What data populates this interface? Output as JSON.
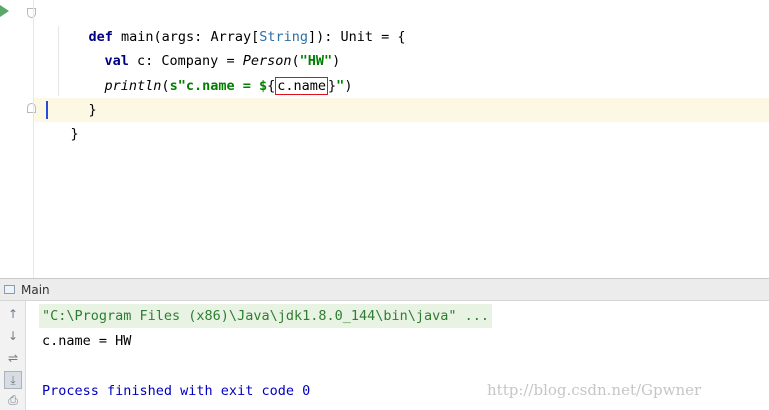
{
  "editor": {
    "lines": [
      {
        "kw": "def",
        "name": " main(args: Array[",
        "type": "String",
        "rest": "]): Unit = {"
      },
      {
        "kw": "val",
        "rest": " c: Company = ",
        "italic": "Person",
        "open": "(",
        "str": "\"HW\"",
        "close": ")"
      },
      {
        "italic": "println",
        "open": "(",
        "str1": "s\"c.name = ",
        "str2": "$",
        "brace_open": "{",
        "boxed": "c.name",
        "brace_close": "}",
        "str3": "\"",
        "close": ")"
      },
      {
        "text": "}"
      },
      {
        "text": "}"
      }
    ]
  },
  "tool_window": {
    "title": "Main",
    "console": {
      "command": "\"C:\\Program Files (x86)\\Java\\jdk1.8.0_144\\bin\\java\" ...",
      "output": "c.name = HW",
      "exit": "Process finished with exit code 0"
    },
    "side_buttons": [
      {
        "icon": "up-arrow-icon",
        "glyph": "↑"
      },
      {
        "icon": "down-arrow-icon",
        "glyph": "↓"
      },
      {
        "icon": "soft-wrap-icon",
        "glyph": "⇌"
      },
      {
        "icon": "scroll-to-end-icon",
        "glyph": "⤓"
      },
      {
        "icon": "print-icon",
        "glyph": "⎙"
      }
    ]
  },
  "watermark": "http://blog.csdn.net/Gpwner",
  "colors": {
    "keyword": "#000080",
    "string": "#008000",
    "highlight_box": "#e0101a",
    "current_line": "#fdf8e3"
  }
}
